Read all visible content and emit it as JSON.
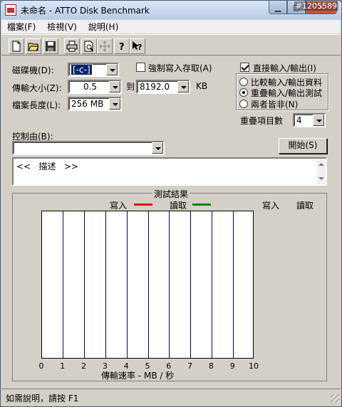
{
  "window": {
    "title": "未命名 - ATTO Disk Benchmark",
    "watermark": "#1205589",
    "min_glyph": "▁",
    "max_glyph": "▢",
    "close_glyph": "✕"
  },
  "menu": [
    "檔案(F)",
    "檢視(V)",
    "說明(H)"
  ],
  "toolbar_icons": [
    "new-file-icon",
    "open-folder-icon",
    "save-icon",
    "print-icon",
    "print-preview-icon",
    "move-icon",
    "help-icon",
    "context-help-icon"
  ],
  "form": {
    "drive_label": "磁碟機(D):",
    "drive_value": "[-c-]",
    "force_write_label": "強制寫入存取(A)",
    "transfer_label": "傳輸大小(Z):",
    "transfer_from": "0.5",
    "to_label": "到",
    "transfer_to": "8192.0",
    "unit_label": "KB",
    "file_length_label": "檔案長度(L):",
    "file_length_value": "256 MB",
    "direct_io_label": "直接輸入/輸出(I)",
    "direct_io_checked": true,
    "radio_options": [
      "比較輸入/輸出資料",
      "重疊輸入/輸出測試",
      "兩者皆非(N)"
    ],
    "radio_selected": 1,
    "queue_label": "重疊項目數",
    "queue_value": "4",
    "controlled_by_label": "控制由(B):",
    "controlled_by_value": "",
    "start_button": "開始(S)",
    "description": "<<   描述   >>"
  },
  "results": {
    "title": "測試結果",
    "legend_write": "寫入",
    "legend_read": "讀取",
    "col_write": "寫入",
    "col_read": "讀取",
    "write_color": "#e01010",
    "read_color": "#108010"
  },
  "chart_data": {
    "type": "bar",
    "xlabel": "傳輸速率 - MB / 秒",
    "xlim": [
      0,
      10
    ],
    "x_ticks": [
      "0",
      "1",
      "2",
      "3",
      "4",
      "5",
      "6",
      "7",
      "8",
      "9",
      "10"
    ],
    "series": [
      {
        "name": "寫入",
        "values": []
      },
      {
        "name": "讀取",
        "values": []
      }
    ],
    "grid": true
  },
  "status": {
    "text": "如需說明，請按 F1"
  }
}
